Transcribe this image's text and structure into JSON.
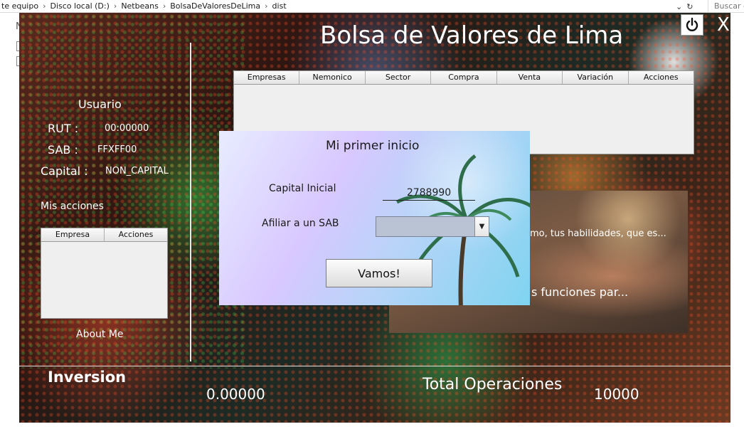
{
  "explorer": {
    "crumbs": [
      "te equipo",
      "Disco local (D:)",
      "Netbeans",
      "BolsaDeValoresDeLima",
      "dist"
    ],
    "search_placeholder": "Buscar e",
    "behind_letter": "N"
  },
  "app": {
    "title": "Bolsa de Valores de Lima",
    "close_label": "X"
  },
  "user": {
    "usuario_label": "Usuario",
    "rut_label": "RUT :",
    "rut_value": "00:00000",
    "sab_label": "SAB :",
    "sab_value": "FFXFF00",
    "capital_label": "Capital :",
    "capital_value": "NON_CAPITAL",
    "mis_acciones_label": "Mis acciones",
    "about_label": "About Me"
  },
  "side_table": {
    "columns": [
      "Empresa",
      "Acciones"
    ]
  },
  "main_table": {
    "columns": [
      "Empresas",
      "Nemonico",
      "Sector",
      "Compra",
      "Venta",
      "Variación",
      "Acciones"
    ]
  },
  "news": {
    "line1": "mo, tus habilidades, que es...",
    "line2": "s funciones par..."
  },
  "dialog": {
    "title": "Mi primer inicio",
    "capital_label": "Capital Inicial",
    "capital_value": "2788990",
    "sab_label": "Afiliar a un SAB",
    "sab_selected": "",
    "button_label": "Vamos!"
  },
  "stats": {
    "inversion_label": "Inversion",
    "inversion_value": "0.00000",
    "total_ops_label": "Total Operaciones",
    "total_ops_value": "10000"
  }
}
